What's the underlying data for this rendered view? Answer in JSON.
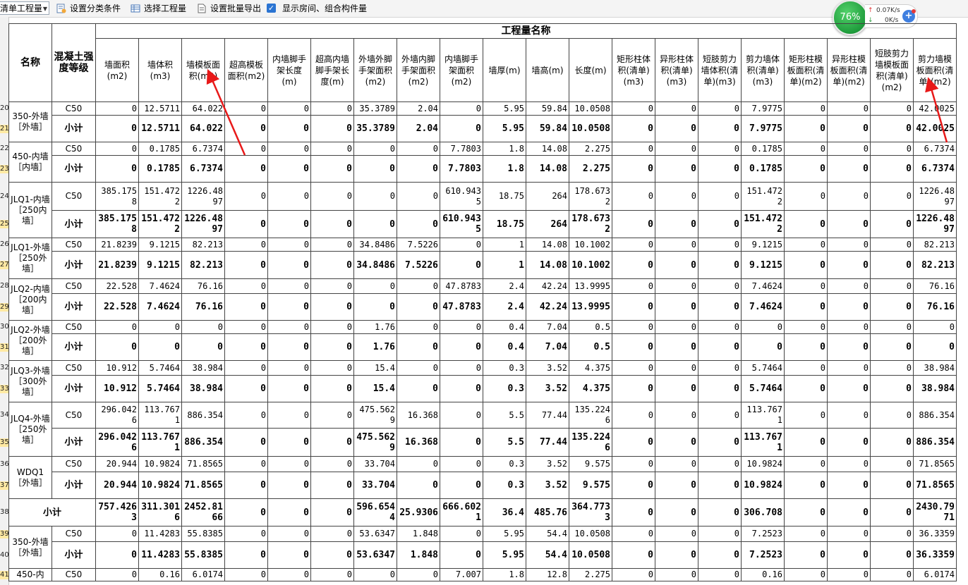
{
  "toolbar": {
    "mode_select": "清单工程量",
    "btn_category": "设置分类条件",
    "btn_select_project": "选择工程量",
    "btn_batch_export": "设置批量导出",
    "chk_show_rooms": "显示房间、组合构件量",
    "chk_show_rooms_checked": true
  },
  "net_widget": {
    "percent": "76%",
    "upload": "0.07K/s",
    "download": "0K/s",
    "plus": "+"
  },
  "header": {
    "group_title": "工程量名称",
    "col_name": "名称",
    "col_grade": "混凝土强度等级",
    "columns": [
      "墙面积(m2)",
      "墙体积(m3)",
      "墙模板面积(m2)",
      "超高模板面积(m2)",
      "内墙脚手架长度(m)",
      "超高内墙脚手架长度(m)",
      "外墙外脚手架面积(m2)",
      "外墙内脚手架面积(m2)",
      "内墙脚手架面积(m2)",
      "墙厚(m)",
      "墙高(m)",
      "长度(m)",
      "矩形柱体积(清单)(m3)",
      "异形柱体积(清单)(m3)",
      "短肢剪力墙体积(清单)(m3)",
      "剪力墙体积(清单)(m3)",
      "矩形柱模板面积(清单)(m2)",
      "异形柱模板面积(清单)(m2)",
      "短肢剪力墙模板面积(清单)(m2)",
      "剪力墙模板面积(清单)(m2)"
    ]
  },
  "row_numbers": [
    "20",
    "21",
    "22",
    "23",
    "24",
    "25",
    "26",
    "27",
    "28",
    "29",
    "30",
    "31",
    "32",
    "33",
    "34",
    "35",
    "36",
    "37",
    "38",
    "39",
    "40",
    "41"
  ],
  "groups": [
    {
      "name": "350-外墙［外墙］",
      "rows": [
        {
          "grade": "C50",
          "values": [
            "0",
            "12.5711",
            "64.022",
            "0",
            "0",
            "0",
            "35.3789",
            "2.04",
            "0",
            "5.95",
            "59.84",
            "10.0508",
            "0",
            "0",
            "0",
            "7.9775",
            "0",
            "0",
            "0",
            "42.0025"
          ]
        },
        {
          "grade": "小计",
          "values": [
            "0",
            "12.5711",
            "64.022",
            "0",
            "0",
            "0",
            "35.3789",
            "2.04",
            "0",
            "5.95",
            "59.84",
            "10.0508",
            "0",
            "0",
            "0",
            "7.9775",
            "0",
            "0",
            "0",
            "42.0025"
          ]
        }
      ]
    },
    {
      "name": "450-内墙［内墙］",
      "rows": [
        {
          "grade": "C50",
          "values": [
            "0",
            "0.1785",
            "6.7374",
            "0",
            "0",
            "0",
            "0",
            "0",
            "7.7803",
            "1.8",
            "14.08",
            "2.275",
            "0",
            "0",
            "0",
            "0.1785",
            "0",
            "0",
            "0",
            "6.7374"
          ]
        },
        {
          "grade": "小计",
          "values": [
            "0",
            "0.1785",
            "6.7374",
            "0",
            "0",
            "0",
            "0",
            "0",
            "7.7803",
            "1.8",
            "14.08",
            "2.275",
            "0",
            "0",
            "0",
            "0.1785",
            "0",
            "0",
            "0",
            "6.7374"
          ]
        }
      ]
    },
    {
      "name": "JLQ1-内墙［250内墙］",
      "rows": [
        {
          "grade": "C50",
          "values": [
            "385.1758",
            "151.4722",
            "1226.4897",
            "0",
            "0",
            "0",
            "0",
            "0",
            "610.9435",
            "18.75",
            "264",
            "178.6732",
            "0",
            "0",
            "0",
            "151.4722",
            "0",
            "0",
            "0",
            "1226.4897"
          ]
        },
        {
          "grade": "小计",
          "values": [
            "385.1758",
            "151.4722",
            "1226.4897",
            "0",
            "0",
            "0",
            "0",
            "0",
            "610.9435",
            "18.75",
            "264",
            "178.6732",
            "0",
            "0",
            "0",
            "151.4722",
            "0",
            "0",
            "0",
            "1226.4897"
          ]
        }
      ]
    },
    {
      "name": "JLQ1-外墙［250外墙］",
      "rows": [
        {
          "grade": "C50",
          "values": [
            "21.8239",
            "9.1215",
            "82.213",
            "0",
            "0",
            "0",
            "34.8486",
            "7.5226",
            "0",
            "1",
            "14.08",
            "10.1002",
            "0",
            "0",
            "0",
            "9.1215",
            "0",
            "0",
            "0",
            "82.213"
          ]
        },
        {
          "grade": "小计",
          "values": [
            "21.8239",
            "9.1215",
            "82.213",
            "0",
            "0",
            "0",
            "34.8486",
            "7.5226",
            "0",
            "1",
            "14.08",
            "10.1002",
            "0",
            "0",
            "0",
            "9.1215",
            "0",
            "0",
            "0",
            "82.213"
          ]
        }
      ]
    },
    {
      "name": "JLQ2-内墙［200内墙］",
      "rows": [
        {
          "grade": "C50",
          "values": [
            "22.528",
            "7.4624",
            "76.16",
            "0",
            "0",
            "0",
            "0",
            "0",
            "47.8783",
            "2.4",
            "42.24",
            "13.9995",
            "0",
            "0",
            "0",
            "7.4624",
            "0",
            "0",
            "0",
            "76.16"
          ]
        },
        {
          "grade": "小计",
          "values": [
            "22.528",
            "7.4624",
            "76.16",
            "0",
            "0",
            "0",
            "0",
            "0",
            "47.8783",
            "2.4",
            "42.24",
            "13.9995",
            "0",
            "0",
            "0",
            "7.4624",
            "0",
            "0",
            "0",
            "76.16"
          ]
        }
      ]
    },
    {
      "name": "JLQ2-外墙［200外墙］",
      "rows": [
        {
          "grade": "C50",
          "values": [
            "0",
            "0",
            "0",
            "0",
            "0",
            "0",
            "1.76",
            "0",
            "0",
            "0.4",
            "7.04",
            "0.5",
            "0",
            "0",
            "0",
            "0",
            "0",
            "0",
            "0",
            "0"
          ]
        },
        {
          "grade": "小计",
          "values": [
            "0",
            "0",
            "0",
            "0",
            "0",
            "0",
            "1.76",
            "0",
            "0",
            "0.4",
            "7.04",
            "0.5",
            "0",
            "0",
            "0",
            "0",
            "0",
            "0",
            "0",
            "0"
          ]
        }
      ]
    },
    {
      "name": "JLQ3-外墙［300外墙］",
      "rows": [
        {
          "grade": "C50",
          "values": [
            "10.912",
            "5.7464",
            "38.984",
            "0",
            "0",
            "0",
            "15.4",
            "0",
            "0",
            "0.3",
            "3.52",
            "4.375",
            "0",
            "0",
            "0",
            "5.7464",
            "0",
            "0",
            "0",
            "38.984"
          ]
        },
        {
          "grade": "小计",
          "values": [
            "10.912",
            "5.7464",
            "38.984",
            "0",
            "0",
            "0",
            "15.4",
            "0",
            "0",
            "0.3",
            "3.52",
            "4.375",
            "0",
            "0",
            "0",
            "5.7464",
            "0",
            "0",
            "0",
            "38.984"
          ]
        }
      ]
    },
    {
      "name": "JLQ4-外墙［250外墙］",
      "rows": [
        {
          "grade": "C50",
          "values": [
            "296.0426",
            "113.7671",
            "886.354",
            "0",
            "0",
            "0",
            "475.5629",
            "16.368",
            "0",
            "5.5",
            "77.44",
            "135.2246",
            "0",
            "0",
            "0",
            "113.7671",
            "0",
            "0",
            "0",
            "886.354"
          ]
        },
        {
          "grade": "小计",
          "values": [
            "296.0426",
            "113.7671",
            "886.354",
            "0",
            "0",
            "0",
            "475.5629",
            "16.368",
            "0",
            "5.5",
            "77.44",
            "135.2246",
            "0",
            "0",
            "0",
            "113.7671",
            "0",
            "0",
            "0",
            "886.354"
          ]
        }
      ]
    },
    {
      "name": "WDQ1［外墙］",
      "rows": [
        {
          "grade": "C50",
          "values": [
            "20.944",
            "10.9824",
            "71.8565",
            "0",
            "0",
            "0",
            "33.704",
            "0",
            "0",
            "0.3",
            "3.52",
            "9.575",
            "0",
            "0",
            "0",
            "10.9824",
            "0",
            "0",
            "0",
            "71.8565"
          ]
        },
        {
          "grade": "小计",
          "values": [
            "20.944",
            "10.9824",
            "71.8565",
            "0",
            "0",
            "0",
            "33.704",
            "0",
            "0",
            "0.3",
            "3.52",
            "9.575",
            "0",
            "0",
            "0",
            "10.9824",
            "0",
            "0",
            "0",
            "71.8565"
          ]
        }
      ]
    }
  ],
  "total_row": {
    "label": "小计",
    "values": [
      "757.4263",
      "311.3016",
      "2452.8166",
      "0",
      "0",
      "0",
      "596.6544",
      "25.9306",
      "666.6021",
      "36.4",
      "485.76",
      "364.7733",
      "0",
      "0",
      "0",
      "306.708",
      "0",
      "0",
      "0",
      "2430.7971"
    ]
  },
  "after_groups": [
    {
      "name": "350-外墙［外墙］",
      "rows": [
        {
          "grade": "C50",
          "values": [
            "0",
            "11.4283",
            "55.8385",
            "0",
            "0",
            "0",
            "53.6347",
            "1.848",
            "0",
            "5.95",
            "54.4",
            "10.0508",
            "0",
            "0",
            "0",
            "7.2523",
            "0",
            "0",
            "0",
            "36.3359"
          ]
        },
        {
          "grade": "小计",
          "values": [
            "0",
            "11.4283",
            "55.8385",
            "0",
            "0",
            "0",
            "53.6347",
            "1.848",
            "0",
            "5.95",
            "54.4",
            "10.0508",
            "0",
            "0",
            "0",
            "7.2523",
            "0",
            "0",
            "0",
            "36.3359"
          ]
        }
      ]
    },
    {
      "name": "450-内",
      "rows": [
        {
          "grade": "C50",
          "values": [
            "0",
            "0.16",
            "6.0174",
            "0",
            "0",
            "0",
            "0",
            "0",
            "7.007",
            "1.8",
            "12.8",
            "2.275",
            "0",
            "0",
            "0",
            "0.16",
            "0",
            "0",
            "0",
            "6.0174"
          ]
        }
      ]
    }
  ],
  "colors": {
    "arrow": "#e81919",
    "row_number_highlight": "#ffe9a3",
    "grid_border": "#444444"
  }
}
